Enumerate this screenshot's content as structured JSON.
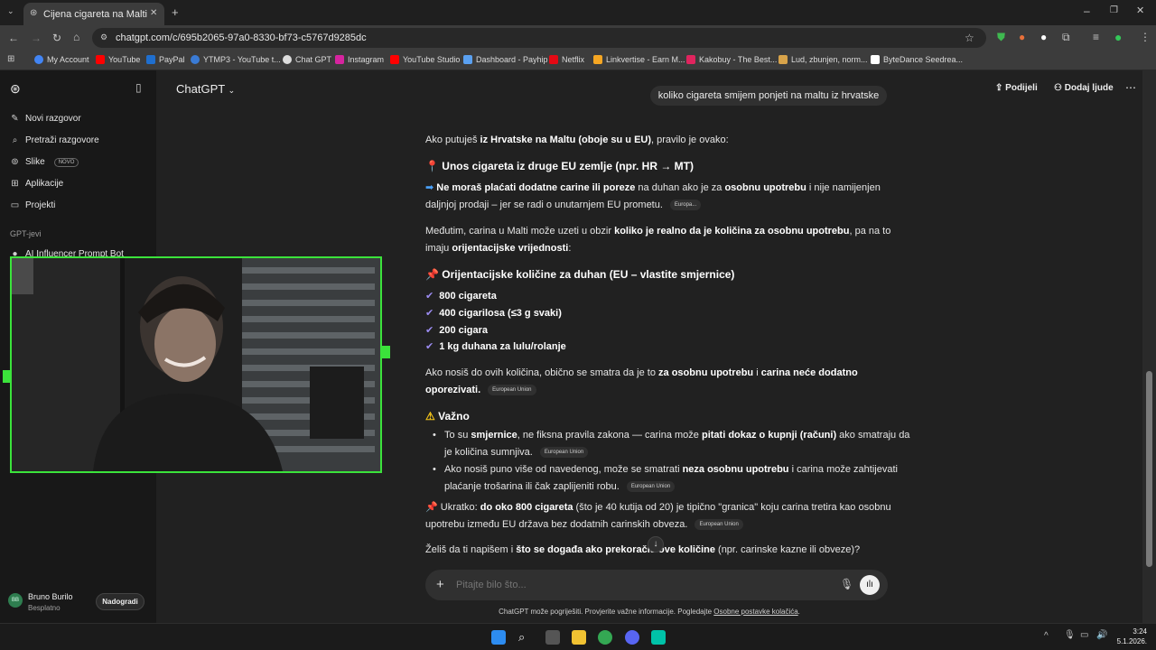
{
  "browser": {
    "tab_title": "Cijena cigareta na Malti",
    "url": "chatgpt.com/c/695b2065-97a0-8330-bf73-c5767d9285dc",
    "bookmarks": [
      "My Account",
      "YouTube",
      "PayPal",
      "YTMP3 - YouTube t...",
      "Chat GPT",
      "Instagram",
      "YouTube Studio",
      "Dashboard - Payhip",
      "Netflix",
      "Linkvertise - Earn M...",
      "Kakobuy - The Best...",
      "Lud, zbunjen, norm...",
      "ByteDance Seedrea..."
    ]
  },
  "sidebar": {
    "items": [
      "Novi razgovor",
      "Pretraži razgovore",
      "Slike",
      "Aplikacije",
      "Projekti"
    ],
    "novo_badge": "NOVO",
    "section_label": "GPT-jevi",
    "gpt_item": "AI Influencer Prompt Bot",
    "user_name": "Bruno Burilo",
    "user_initials": "BB",
    "user_plan": "Besplatno",
    "upgrade_label": "Nadogradi"
  },
  "header": {
    "model": "ChatGPT",
    "share": "Podijeli",
    "add_people": "Dodaj ljude"
  },
  "user_message": "koliko cigareta smijem ponjeti na maltu iz hrvatske",
  "answer": {
    "p1_pre": "Ako putuješ ",
    "p1_bold": "iz Hrvatske na Maltu (oboje su u EU)",
    "p1_post": ", pravilo je ovako:",
    "h1": "Unos cigareta iz druge EU zemlje (npr. HR → MT)",
    "p2_bold1": "Ne moraš plaćati dodatne carine ili poreze",
    "p2_mid": " na duhan ako je za ",
    "p2_bold2": "osobnu upotrebu",
    "p2_post": " i nije namijenjen",
    "p2_line2": "daljnjoj prodaji – jer se radi o unutarnjem EU prometu.",
    "tag_europa": "Europa...",
    "p3_pre": "Međutim, carina u Malti može uzeti u obzir ",
    "p3_bold": "koliko je realno da je količina za osobnu upotrebu",
    "p3_post": ", pa na to",
    "p3_line2_pre": "imaju ",
    "p3_line2_bold": "orijentacijske vrijednosti",
    "p3_line2_post": ":",
    "h2": "Orijentacijske količine za duhan (EU – vlastite smjernice)",
    "list": [
      "800 cigareta",
      "400 cigarilosa (≤3 g svaki)",
      "200 cigara",
      "1 kg duhana za lulu/rolanje"
    ],
    "p4_pre": "Ako nosiš do ovih količina, obično se smatra da je to ",
    "p4_bold": "za osobnu upotrebu",
    "p4_mid": " i ",
    "p4_bold2": "carina neće dodatno",
    "p4_line2_bold": "oporezivati.",
    "tag_eu": "European Union",
    "h3": "Važno",
    "b1_pre": "To su ",
    "b1_bold": "smjernice",
    "b1_mid": ", ne fiksna pravila zakona — carina može ",
    "b1_bold2": "pitati dokaz o kupnji (računi)",
    "b1_post": " ako smatraju da",
    "b1_line2": "je količina sumnjiva.",
    "b2_pre": "Ako nosiš puno više od navedenog, može se smatrati ",
    "b2_bold": "neza osobnu upotrebu",
    "b2_post": " i carina može zahtijevati",
    "b2_line2": "plaćanje trošarina ili čak zaplijeniti robu.",
    "p5_pre": "Ukratko: ",
    "p5_bold": "do oko 800 cigareta",
    "p5_post": " (što je 40 kutija od 20) je tipično \"granica\" koju carina tretira kao osobnu",
    "p5_line2": "upotrebu između EU država bez dodatnih carinskih obveza.",
    "p6_pre": "Želiš da ti napišem i ",
    "p6_bold": "što se događa ako prekoračiš ove količine",
    "p6_post": " (npr. carinske kazne ili obveze)?"
  },
  "composer": {
    "placeholder": "Pitajte bilo što..."
  },
  "footer": {
    "note": "ChatGPT može pogriješiti. Provjerite važne informacije. Pogledajte ",
    "link": "Osobne postavke kolačića",
    "end": "."
  },
  "taskbar": {
    "time": "3:24",
    "date": "5.1.2026."
  },
  "colors": {
    "accent_green": "#3be33b",
    "check_purple": "#9c8cf2",
    "bg": "#212121",
    "sidebar_bg": "#181818"
  }
}
